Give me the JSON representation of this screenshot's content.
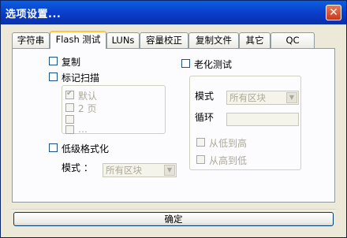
{
  "window": {
    "title": "选项设置...",
    "close_glyph": "✕"
  },
  "tabs": [
    {
      "label": "字符串",
      "active": false
    },
    {
      "label": "Flash 测试",
      "active": true
    },
    {
      "label": "LUNs",
      "active": false
    },
    {
      "label": "容量校正",
      "active": false
    },
    {
      "label": "复制文件",
      "active": false
    },
    {
      "label": "其它",
      "active": false
    },
    {
      "label": "QC",
      "active": false
    }
  ],
  "left": {
    "copy": {
      "label": "复制",
      "checked": false
    },
    "mark_scan": {
      "label": "标记扫描",
      "checked": false
    },
    "scan_options": [
      {
        "label": "默认",
        "checked": true,
        "enabled": false
      },
      {
        "label": "2 页",
        "checked": false,
        "enabled": false
      },
      {
        "label": "",
        "checked": false,
        "enabled": false
      },
      {
        "label": "…",
        "checked": false,
        "enabled": false
      }
    ],
    "low_format": {
      "label": "低级格式化",
      "checked": false
    },
    "mode": {
      "label": "模式 ：",
      "value": "所有区块"
    }
  },
  "right": {
    "aging": {
      "label": "老化测试",
      "checked": false
    },
    "mode": {
      "label": "模式",
      "value": "所有区块"
    },
    "loop": {
      "label": "循环",
      "value": ""
    },
    "low_to_high": {
      "label": "从低到高",
      "checked": false,
      "enabled": false
    },
    "high_to_low": {
      "label": "从高到低",
      "checked": false,
      "enabled": false
    }
  },
  "buttons": {
    "ok": "确定"
  },
  "icons": {
    "checkmark": "✔",
    "dropdown": "▼"
  }
}
